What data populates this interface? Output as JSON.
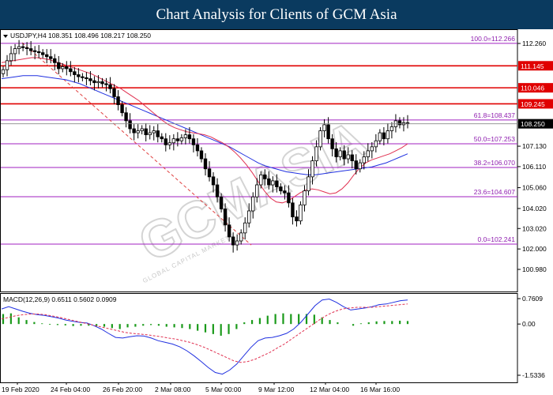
{
  "banner": {
    "title": "Chart Analysis for Clients of GCM Asia"
  },
  "watermark": {
    "text": "GCMASIA",
    "sub": "GLOBAL CAPITAL MARKETS"
  },
  "chart_data": [
    {
      "type": "candlestick",
      "title": "USDJPY,H4  108.351 108.496 108.217 108.250",
      "price_scale": {
        "min": 100.98,
        "max": 112.26
      },
      "y_ticks": [
        112.26,
        111.145,
        110.046,
        109.245,
        108.25,
        107.13,
        106.11,
        105.06,
        104.02,
        103.02,
        102.0,
        100.98
      ],
      "y_tick_labels": [
        "112.260",
        "111.145",
        "110.046",
        "109.245",
        "108.250",
        "107.130",
        "106.110",
        "105.060",
        "104.020",
        "103.020",
        "102.000",
        "100.980"
      ],
      "x_labels": [
        "19 Feb 2020",
        "24 Feb 04:00",
        "26 Feb 20:00",
        "2 Mar 08:00",
        "5 Mar 00:00",
        "9 Mar 12:00",
        "12 Mar 04:00",
        "16 Mar 16:00"
      ],
      "current_price": {
        "value": 108.25,
        "label": "108.250"
      },
      "resistance_levels": [
        {
          "value": 111.145,
          "label": "111.145"
        },
        {
          "value": 110.046,
          "label": "110.046"
        },
        {
          "value": 109.245,
          "label": "109.245"
        }
      ],
      "fibonacci_levels": [
        {
          "value": 112.266,
          "label": "100.0=112.266"
        },
        {
          "value": 108.437,
          "label": "61.8=108.437"
        },
        {
          "value": 107.253,
          "label": "50.0=107.253"
        },
        {
          "value": 106.07,
          "label": "38.2=106.070"
        },
        {
          "value": 104.607,
          "label": "23.6=104.607"
        },
        {
          "value": 102.241,
          "label": "0.0=102.241"
        }
      ],
      "close_series": [
        110.95,
        111.4,
        111.75,
        112.0,
        112.1,
        112.05,
        112.0,
        111.9,
        111.85,
        111.8,
        111.7,
        111.6,
        111.5,
        111.3,
        111.0,
        111.1,
        111.0,
        110.85,
        110.7,
        110.6,
        110.55,
        110.5,
        110.4,
        110.3,
        110.35,
        110.25,
        110.2,
        110.0,
        109.6,
        109.2,
        108.8,
        108.4,
        108.0,
        107.8,
        107.9,
        108.0,
        107.7,
        107.8,
        107.9,
        107.6,
        107.5,
        107.2,
        107.3,
        107.5,
        107.4,
        107.55,
        107.7,
        107.5,
        107.2,
        106.9,
        106.5,
        106.0,
        105.6,
        105.2,
        104.6,
        104.0,
        103.2,
        102.6,
        102.2,
        102.4,
        102.8,
        103.3,
        103.9,
        104.6,
        105.2,
        105.7,
        105.5,
        105.2,
        105.4,
        105.1,
        104.9,
        104.8,
        104.3,
        103.6,
        103.4,
        104.2,
        104.9,
        105.6,
        106.4,
        107.1,
        107.9,
        108.2,
        107.5,
        107.0,
        106.6,
        106.9,
        106.5,
        106.7,
        106.4,
        106.0,
        106.3,
        106.6,
        106.9,
        107.1,
        107.4,
        107.8,
        107.5,
        107.9,
        108.1,
        108.4,
        108.2,
        108.3,
        108.25
      ],
      "ma_fast": [
        111.3,
        111.35,
        111.4,
        111.45,
        111.5,
        111.55,
        111.55,
        111.5,
        111.45,
        111.35,
        111.25,
        111.15,
        111.05,
        110.95,
        110.85,
        110.75,
        110.6,
        110.45,
        110.3,
        110.15,
        110.0,
        109.8,
        109.6,
        109.4,
        109.15,
        108.9,
        108.65,
        108.4,
        108.2,
        108.05,
        107.95,
        107.85,
        107.8,
        107.75,
        107.7,
        107.6,
        107.45,
        107.3,
        107.1,
        106.85,
        106.55,
        106.2,
        105.8,
        105.35,
        104.9,
        104.55,
        104.35,
        104.3,
        104.4,
        104.6,
        104.8,
        104.95,
        105.0,
        104.95,
        104.85,
        104.75,
        104.8,
        105.0,
        105.3,
        105.7,
        106.05,
        106.3,
        106.45,
        106.55,
        106.65,
        106.75,
        106.9,
        107.05,
        107.25
      ],
      "ma_slow": [
        110.5,
        110.55,
        110.6,
        110.65,
        110.65,
        110.65,
        110.6,
        110.55,
        110.5,
        110.45,
        110.35,
        110.25,
        110.1,
        109.95,
        109.8,
        109.65,
        109.5,
        109.35,
        109.2,
        109.05,
        108.9,
        108.75,
        108.6,
        108.45,
        108.3,
        108.15,
        108.0,
        107.85,
        107.7,
        107.55,
        107.4,
        107.25,
        107.1,
        106.9,
        106.7,
        106.5,
        106.3,
        106.15,
        106.05,
        105.95,
        105.85,
        105.8,
        105.75,
        105.7,
        105.7,
        105.75,
        105.8,
        105.85,
        105.9,
        105.95,
        106.0,
        106.05,
        106.1,
        106.2,
        106.3,
        106.45,
        106.6,
        106.75
      ],
      "macd": {
        "title": "MACD(12,26,9) 0.6511 0.5602 0.0909",
        "scale": {
          "min": -1.5336,
          "max": 0.7609
        },
        "y_tick_labels": [
          "0.7609",
          "0.00",
          "-1.5336"
        ],
        "main": [
          0.45,
          0.52,
          0.45,
          0.38,
          0.32,
          0.28,
          0.26,
          0.22,
          0.18,
          0.12,
          0.08,
          0.05,
          0.03,
          -0.05,
          -0.15,
          -0.28,
          -0.4,
          -0.42,
          -0.38,
          -0.35,
          -0.36,
          -0.42,
          -0.5,
          -0.55,
          -0.6,
          -0.68,
          -0.8,
          -0.95,
          -1.12,
          -1.3,
          -1.45,
          -1.5,
          -1.38,
          -1.2,
          -0.95,
          -0.7,
          -0.5,
          -0.42,
          -0.4,
          -0.35,
          -0.28,
          -0.15,
          0.05,
          0.3,
          0.55,
          0.72,
          0.75,
          0.65,
          0.52,
          0.42,
          0.45,
          0.48,
          0.52,
          0.58,
          0.6,
          0.65,
          0.7,
          0.72
        ],
        "signal": [
          0.15,
          0.2,
          0.25,
          0.28,
          0.3,
          0.3,
          0.28,
          0.24,
          0.2,
          0.15,
          0.1,
          0.05,
          0.0,
          -0.05,
          -0.1,
          -0.15,
          -0.2,
          -0.25,
          -0.28,
          -0.3,
          -0.32,
          -0.35,
          -0.38,
          -0.42,
          -0.45,
          -0.5,
          -0.55,
          -0.62,
          -0.7,
          -0.8,
          -0.9,
          -1.0,
          -1.1,
          -1.15,
          -1.12,
          -1.05,
          -0.95,
          -0.85,
          -0.72,
          -0.6,
          -0.45,
          -0.3,
          -0.15,
          0.0,
          0.15,
          0.28,
          0.38,
          0.45,
          0.48,
          0.5,
          0.5,
          0.5,
          0.52,
          0.54,
          0.56,
          0.58,
          0.6
        ],
        "histogram": [
          0.3,
          0.32,
          0.2,
          0.12,
          0.06,
          0.02,
          -0.02,
          -0.03,
          -0.04,
          -0.06,
          -0.05,
          -0.05,
          -0.07,
          -0.08,
          -0.12,
          -0.15,
          -0.1,
          -0.08,
          -0.05,
          -0.03,
          -0.05,
          -0.08,
          -0.1,
          -0.12,
          -0.15,
          -0.2,
          -0.25,
          -0.3,
          -0.35,
          -0.3,
          -0.15,
          0.05,
          0.12,
          0.18,
          0.25,
          0.3,
          0.32,
          0.3,
          0.3,
          0.3,
          0.28,
          0.2,
          0.12,
          0.05,
          0.0,
          -0.05,
          0.02,
          0.05,
          0.08,
          0.09,
          0.09,
          0.1,
          0.09
        ]
      }
    }
  ]
}
